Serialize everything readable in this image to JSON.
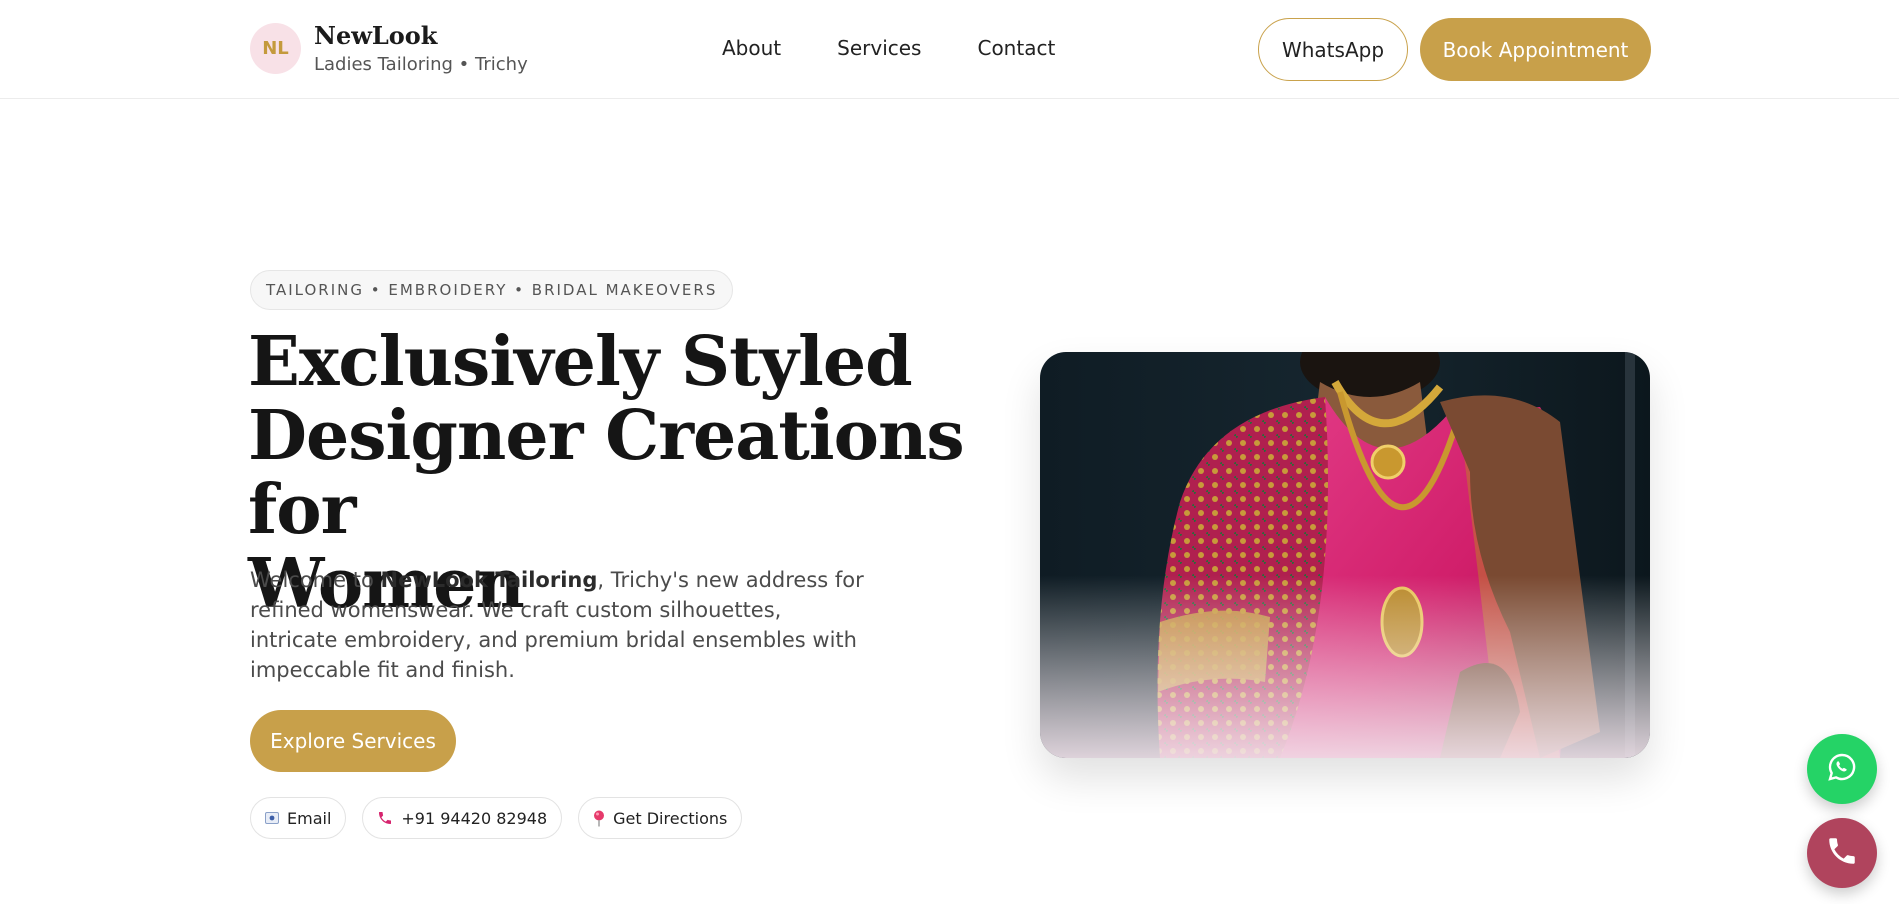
{
  "header": {
    "logo_initials": "NL",
    "brand_name": "NewLook",
    "brand_sub": "Ladies Tailoring • Trichy",
    "nav": [
      {
        "label": "About"
      },
      {
        "label": "Services"
      },
      {
        "label": "Contact"
      }
    ],
    "whatsapp_label": "WhatsApp",
    "book_label": "Book Appointment"
  },
  "hero": {
    "tagline": "TAILORING • EMBROIDERY • BRIDAL MAKEOVERS",
    "headline_line1": "Exclusively Styled",
    "headline_line2": "Designer Creations for",
    "headline_line3": "Women",
    "intro_prefix": "Welcome to ",
    "intro_brand": "NewLook Tailoring",
    "intro_suffix": ", Trichy's new address for refined womenswear. We craft custom silhouettes, intricate embroidery, and premium bridal ensembles with impeccable fit and finish.",
    "cta_label": "Explore Services",
    "contacts": [
      {
        "label": "Email",
        "icon": "email-icon"
      },
      {
        "label": "+91 94420 82948",
        "icon": "phone-icon"
      },
      {
        "label": "Get Directions",
        "icon": "location-pin-icon"
      }
    ]
  },
  "colors": {
    "gold": "#c8a04a",
    "whatsapp_green": "#25d366",
    "call_red": "#b0445d",
    "logo_bg": "#f8e1e7"
  }
}
